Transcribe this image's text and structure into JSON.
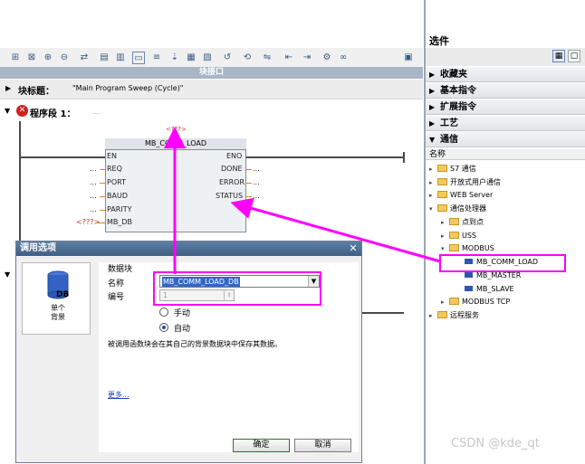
{
  "editor": {
    "block_interface_label": "块接口",
    "block_title_label": "块标题：",
    "block_title_value": "\"Main Program Sweep (Cycle)\"",
    "segment_label": "程序段 1：",
    "segment_comment": ".....",
    "fb": {
      "top_param": "<???>",
      "name": "MB_COMM_LOAD",
      "inputs": [
        "EN",
        "REQ",
        "PORT",
        "BAUD",
        "PARITY",
        "MB_DB"
      ],
      "outputs": [
        "ENO",
        "DONE",
        "ERROR",
        "STATUS"
      ],
      "input_values": [
        "",
        "...",
        "...",
        "...",
        "...",
        "<???>"
      ],
      "output_values": [
        "",
        "...",
        "...",
        "..."
      ]
    }
  },
  "catalog": {
    "title": "选件",
    "sections": [
      {
        "label": "收藏夹",
        "expanded": false
      },
      {
        "label": "基本指令",
        "expanded": false
      },
      {
        "label": "扩展指令",
        "expanded": false
      },
      {
        "label": "工艺",
        "expanded": false
      },
      {
        "label": "通信",
        "expanded": true
      }
    ],
    "column_header": "名称",
    "tree": [
      {
        "label": "S7 通信",
        "type": "folder",
        "toggle": "▸"
      },
      {
        "label": "开放式用户通信",
        "type": "folder",
        "toggle": "▸"
      },
      {
        "label": "WEB Server",
        "type": "folder",
        "toggle": "▸"
      },
      {
        "label": "通信处理器",
        "type": "folder",
        "toggle": "▾"
      },
      {
        "label": "点到点",
        "type": "folder",
        "toggle": "▸"
      },
      {
        "label": "USS",
        "type": "folder",
        "toggle": "▸"
      },
      {
        "label": "MODBUS",
        "type": "folder",
        "toggle": "▾"
      },
      {
        "label": "MB_COMM_LOAD",
        "type": "block",
        "toggle": ""
      },
      {
        "label": "MB_MASTER",
        "type": "block",
        "toggle": ""
      },
      {
        "label": "MB_SLAVE",
        "type": "block",
        "toggle": ""
      },
      {
        "label": "MODBUS TCP",
        "type": "folder",
        "toggle": "▸"
      },
      {
        "label": "远程服务",
        "type": "folder",
        "toggle": "▸"
      }
    ]
  },
  "dialog": {
    "title": "调用选项",
    "close": "✕",
    "left_icon_label": "DB",
    "left_caption": "单个\n背景",
    "section_label": "数据块",
    "name_label": "名称",
    "name_value": "MB_COMM_LOAD_DB",
    "number_label": "编号",
    "number_value": "1",
    "radio_manual": "手动",
    "radio_auto": "自动",
    "description": "被调用函数块会在其自己的背景数据块中保存其数据。",
    "more_link": "更多...",
    "ok": "确定",
    "cancel": "取消"
  },
  "watermark": "CSDN @kde_qt",
  "colors": {
    "annotation": "#ff00ff",
    "title_bar": "#4a6b92",
    "selection": "#3168c6"
  }
}
